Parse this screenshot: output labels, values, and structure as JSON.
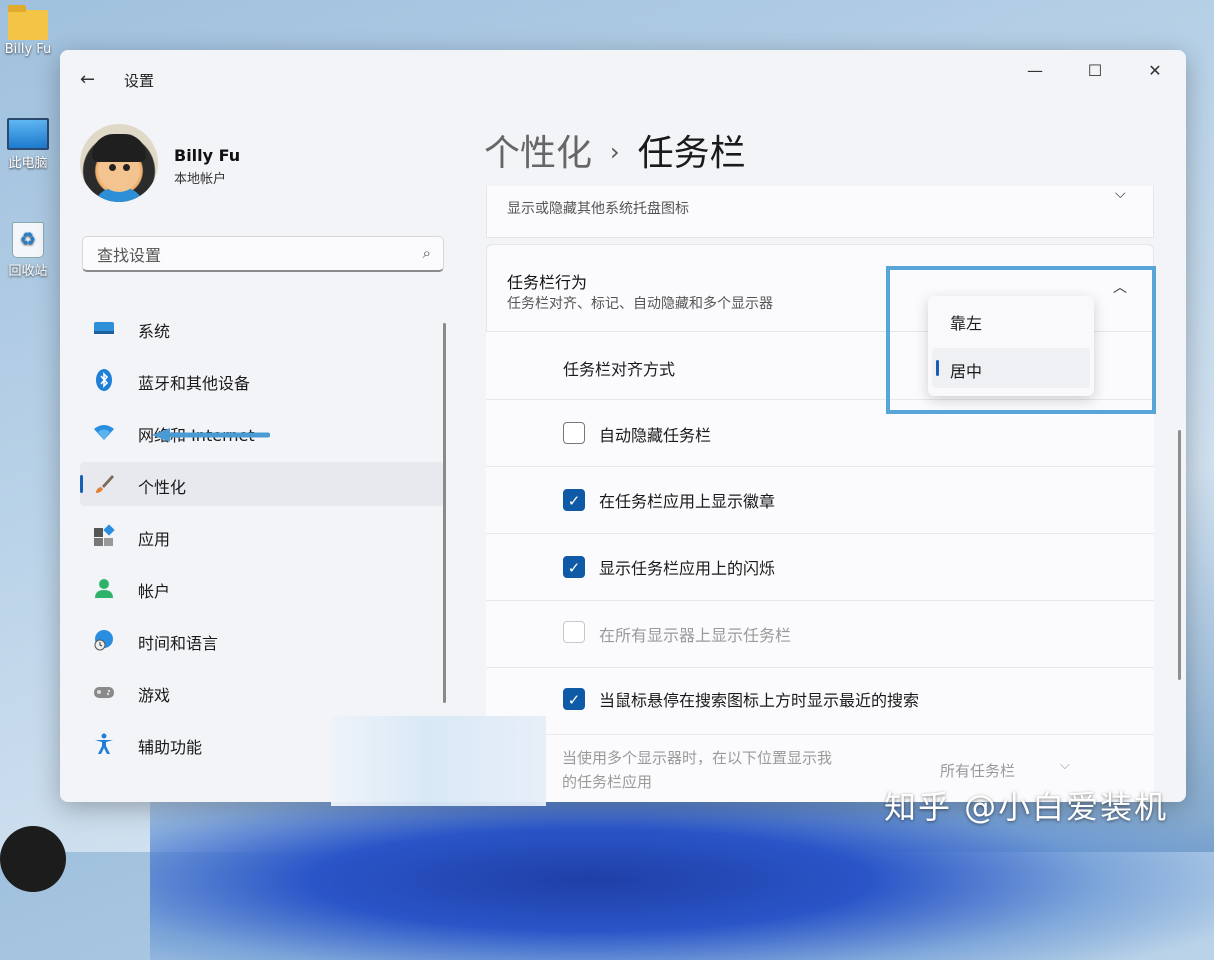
{
  "desktop": {
    "icons": [
      {
        "label": "Billy Fu",
        "icon": "folder-icon"
      },
      {
        "label": "此电脑",
        "icon": "computer-icon"
      },
      {
        "label": "回收站",
        "icon": "recycle-bin-icon"
      }
    ]
  },
  "window": {
    "app_title": "设置",
    "controls": {
      "minimize": "—",
      "maximize": "☐",
      "close": "✕"
    }
  },
  "user": {
    "name": "Billy Fu",
    "account_type": "本地帐户"
  },
  "search": {
    "placeholder": "查找设置"
  },
  "sidebar": {
    "items": [
      {
        "label": "系统",
        "icon": "system-icon"
      },
      {
        "label": "蓝牙和其他设备",
        "icon": "bluetooth-icon"
      },
      {
        "label": "网络和 Internet",
        "icon": "wifi-icon"
      },
      {
        "label": "个性化",
        "icon": "brush-icon",
        "active": true
      },
      {
        "label": "应用",
        "icon": "apps-icon"
      },
      {
        "label": "帐户",
        "icon": "account-icon"
      },
      {
        "label": "时间和语言",
        "icon": "time-language-icon"
      },
      {
        "label": "游戏",
        "icon": "gamepad-icon"
      },
      {
        "label": "辅助功能",
        "icon": "accessibility-icon"
      }
    ]
  },
  "breadcrumb": {
    "parent": "个性化",
    "separator": "›",
    "current": "任务栏"
  },
  "content": {
    "other_tray": {
      "subtitle": "显示或隐藏其他系统托盘图标"
    },
    "behaviors": {
      "title": "任务栏行为",
      "subtitle": "任务栏对齐、标记、自动隐藏和多个显示器",
      "alignment_label": "任务栏对齐方式",
      "alignment_options": [
        "靠左",
        "居中"
      ],
      "alignment_selected": "居中",
      "checks": [
        {
          "label": "自动隐藏任务栏",
          "checked": false,
          "enabled": true
        },
        {
          "label": "在任务栏应用上显示徽章",
          "checked": true,
          "enabled": true
        },
        {
          "label": "显示任务栏应用上的闪烁",
          "checked": true,
          "enabled": true
        },
        {
          "label": "在所有显示器上显示任务栏",
          "checked": false,
          "enabled": false
        },
        {
          "label": "当鼠标悬停在搜索图标上方时显示最近的搜索",
          "checked": true,
          "enabled": true
        }
      ],
      "multi_display_label_line1": "当使用多个显示器时，在以下位置显示我",
      "multi_display_label_line2": "的任务栏应用",
      "multi_display_value": "所有任务栏"
    }
  },
  "watermark": "知乎 @小白爱装机",
  "colors": {
    "accent": "#0f5aa6",
    "highlight_box": "#58a6d8",
    "arrow": "#4a9bd4"
  }
}
